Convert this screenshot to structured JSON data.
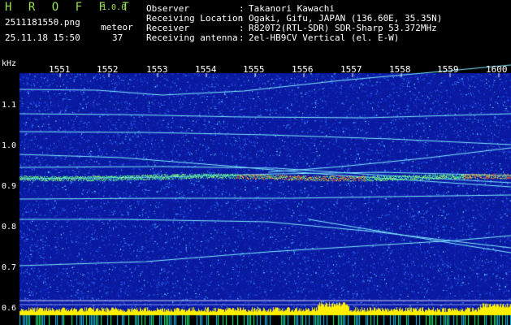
{
  "header": {
    "app_title": "H R O F F T",
    "app_version": "1.0.0",
    "filename": "2511181550.png",
    "datetime": "25.11.18 15:50",
    "meteor_label": "meteor",
    "meteor_count": "37"
  },
  "info": [
    {
      "label": "Observer",
      "value": "Takanori Kawachi"
    },
    {
      "label": "Receiving Location",
      "value": "Ogaki, Gifu, JAPAN (136.60E, 35.35N)"
    },
    {
      "label": "Receiver",
      "value": "R820T2(RTL-SDR) SDR-Sharp 53.372MHz"
    },
    {
      "label": "Receiving antenna",
      "value": "2el-HB9CV Vertical (el. E-W)"
    }
  ],
  "info_separator": ":",
  "spectrogram": {
    "freq_unit": "kHz",
    "time_ticks": [
      "1551",
      "1552",
      "1553",
      "1554",
      "1555",
      "1556",
      "1557",
      "1558",
      "1559",
      "1600"
    ],
    "freq_ticks": [
      "1.1",
      "1.0",
      "0.9",
      "0.8",
      "0.7",
      "0.6"
    ],
    "colors": {
      "background": "#0a1aa0",
      "trace": "#7fe8ff",
      "hot": "#ff3030",
      "band": "#ffee00"
    }
  }
}
